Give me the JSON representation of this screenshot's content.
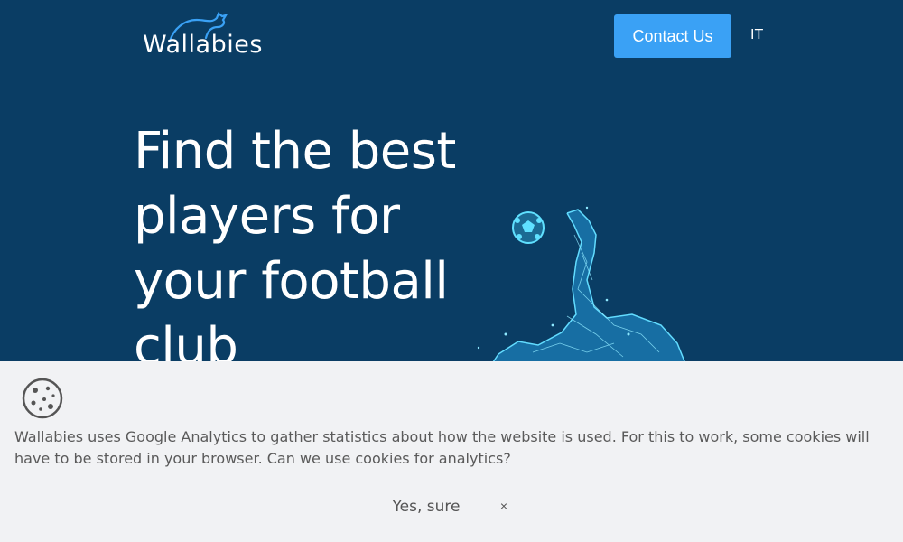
{
  "header": {
    "logo_text": "Wallabies",
    "contact_label": "Contact Us",
    "language_label": "IT"
  },
  "hero": {
    "title": "Find the best players for your football club"
  },
  "cookie_banner": {
    "icon": "cookie-icon",
    "message": "Wallabies uses Google Analytics to gather statistics about how the website is used. For this to work, some cookies will have to be stored in your browser. Can we use cookies for analytics?",
    "accept_label": "Yes, sure",
    "close_label": "×"
  },
  "colors": {
    "background": "#0a3d64",
    "accent": "#3aa1f5",
    "banner": "#f1f2f4",
    "illustration": "#38c4ff"
  }
}
